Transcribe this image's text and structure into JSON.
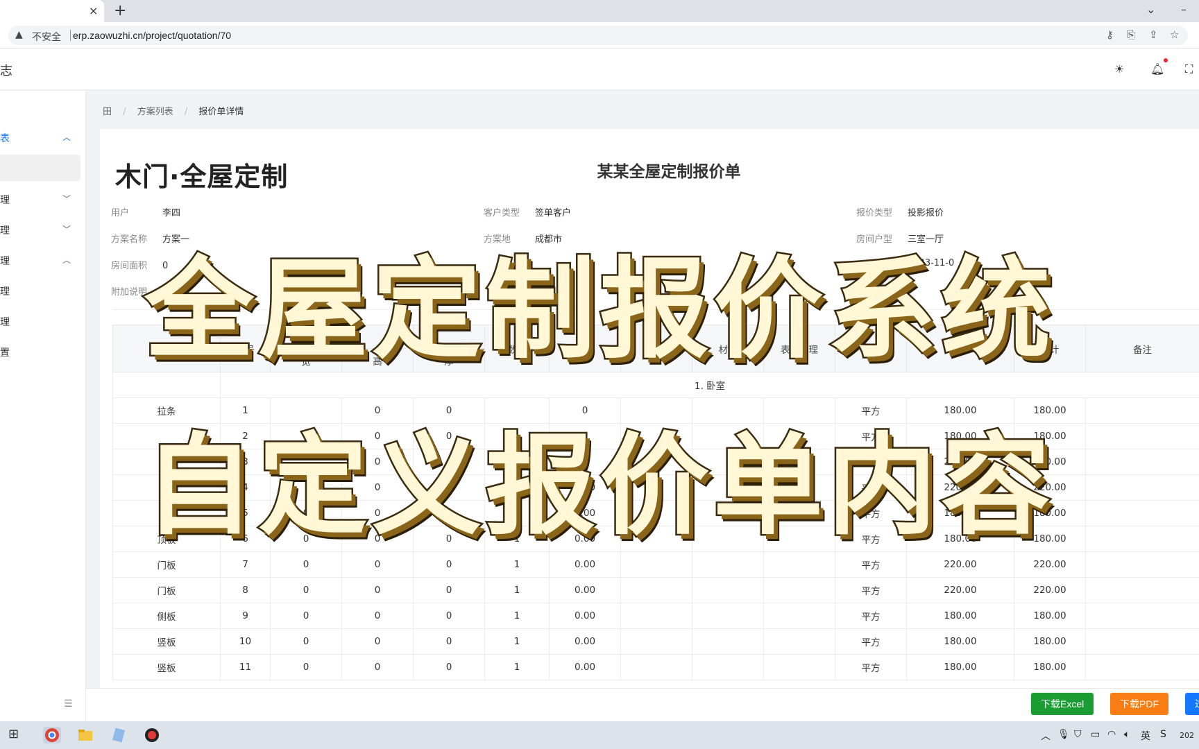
{
  "browser": {
    "tab_close": "×",
    "new_tab": "+",
    "security_label": "不安全",
    "url": "erp.zaowuzhi.cn/project/quotation/70"
  },
  "header": {
    "title_fragment": "志"
  },
  "sidebar": {
    "items": [
      {
        "label": "表",
        "chevron": "^"
      },
      {
        "label": "理",
        "chevron": "v"
      },
      {
        "label": "理",
        "chevron": "v"
      },
      {
        "label": "理",
        "chevron": "^"
      },
      {
        "label": "理"
      },
      {
        "label": "理"
      },
      {
        "label": "置"
      }
    ]
  },
  "breadcrumb": {
    "home": "田",
    "level1": "方案列表",
    "level2": "报价单详情"
  },
  "document": {
    "brand": "木门·全屋定制",
    "title": "某某全屋定制报价单",
    "fields": [
      {
        "key": "用户",
        "value": "李四"
      },
      {
        "key": "客户类型",
        "value": "签单客户"
      },
      {
        "key": "报价类型",
        "value": "投影报价"
      },
      {
        "key": "方案名称",
        "value": "方案一"
      },
      {
        "key": "方案地",
        "value": "成都市"
      },
      {
        "key": "房间户型",
        "value": "三室一厅"
      },
      {
        "key": "房间面积",
        "value": "0"
      },
      {
        "key": "",
        "value": ""
      },
      {
        "key": "",
        "value": "2023-11-0"
      },
      {
        "key": "附加说明",
        "value": ""
      }
    ]
  },
  "table": {
    "headers": [
      "名称",
      "序号",
      "宽",
      "高",
      "厚",
      "数量",
      "面积",
      "品牌",
      "材质",
      "表面处理",
      "单位",
      "单价",
      "小计",
      "备注"
    ],
    "group_label": "1. 卧室",
    "rows": [
      {
        "name": "拉条",
        "no": "1",
        "w": "",
        "h": "0",
        "d": "0",
        "qty": "",
        "area": "0",
        "unit": "平方",
        "price": "180.00",
        "total": "180.00"
      },
      {
        "name": "",
        "no": "2",
        "w": "0",
        "h": "0",
        "d": "0",
        "qty": "",
        "area": "",
        "unit": "平方",
        "price": "180.00",
        "total": "180.00"
      },
      {
        "name": "",
        "no": "3",
        "w": "",
        "h": "0",
        "d": "",
        "qty": "",
        "area": "",
        "unit": "平方",
        "price": "220.00",
        "total": "220.00"
      },
      {
        "name": "",
        "no": "4",
        "w": "",
        "h": "0",
        "d": "",
        "qty": "",
        "area": "0.00",
        "unit": "平方",
        "price": "220.00",
        "total": "220.00"
      },
      {
        "name": "",
        "no": "5",
        "w": "0",
        "h": "0",
        "d": "0",
        "qty": "1",
        "area": "0.00",
        "unit": "平方",
        "price": "180.00",
        "total": "180.00"
      },
      {
        "name": "顶板",
        "no": "6",
        "w": "0",
        "h": "0",
        "d": "0",
        "qty": "1",
        "area": "0.00",
        "unit": "平方",
        "price": "180.00",
        "total": "180.00"
      },
      {
        "name": "门板",
        "no": "7",
        "w": "0",
        "h": "0",
        "d": "0",
        "qty": "1",
        "area": "0.00",
        "unit": "平方",
        "price": "220.00",
        "total": "220.00"
      },
      {
        "name": "门板",
        "no": "8",
        "w": "0",
        "h": "0",
        "d": "0",
        "qty": "1",
        "area": "0.00",
        "unit": "平方",
        "price": "220.00",
        "total": "220.00"
      },
      {
        "name": "侧板",
        "no": "9",
        "w": "0",
        "h": "0",
        "d": "0",
        "qty": "1",
        "area": "0.00",
        "unit": "平方",
        "price": "180.00",
        "total": "180.00"
      },
      {
        "name": "竖板",
        "no": "10",
        "w": "0",
        "h": "0",
        "d": "0",
        "qty": "1",
        "area": "0.00",
        "unit": "平方",
        "price": "180.00",
        "total": "180.00"
      },
      {
        "name": "竖板",
        "no": "11",
        "w": "0",
        "h": "0",
        "d": "0",
        "qty": "1",
        "area": "0.00",
        "unit": "平方",
        "price": "180.00",
        "total": "180.00"
      }
    ]
  },
  "actions": {
    "excel": "下载Excel",
    "pdf": "下载PDF",
    "more": "过"
  },
  "overlay": {
    "line1": "全屋定制报价系统",
    "line2": "自定义报价单内容"
  },
  "taskbar": {
    "ime": "英",
    "clock": "202"
  },
  "colors": {
    "primary": "#1677ff",
    "excel": "#1a9e33",
    "pdf": "#fa7d13"
  }
}
